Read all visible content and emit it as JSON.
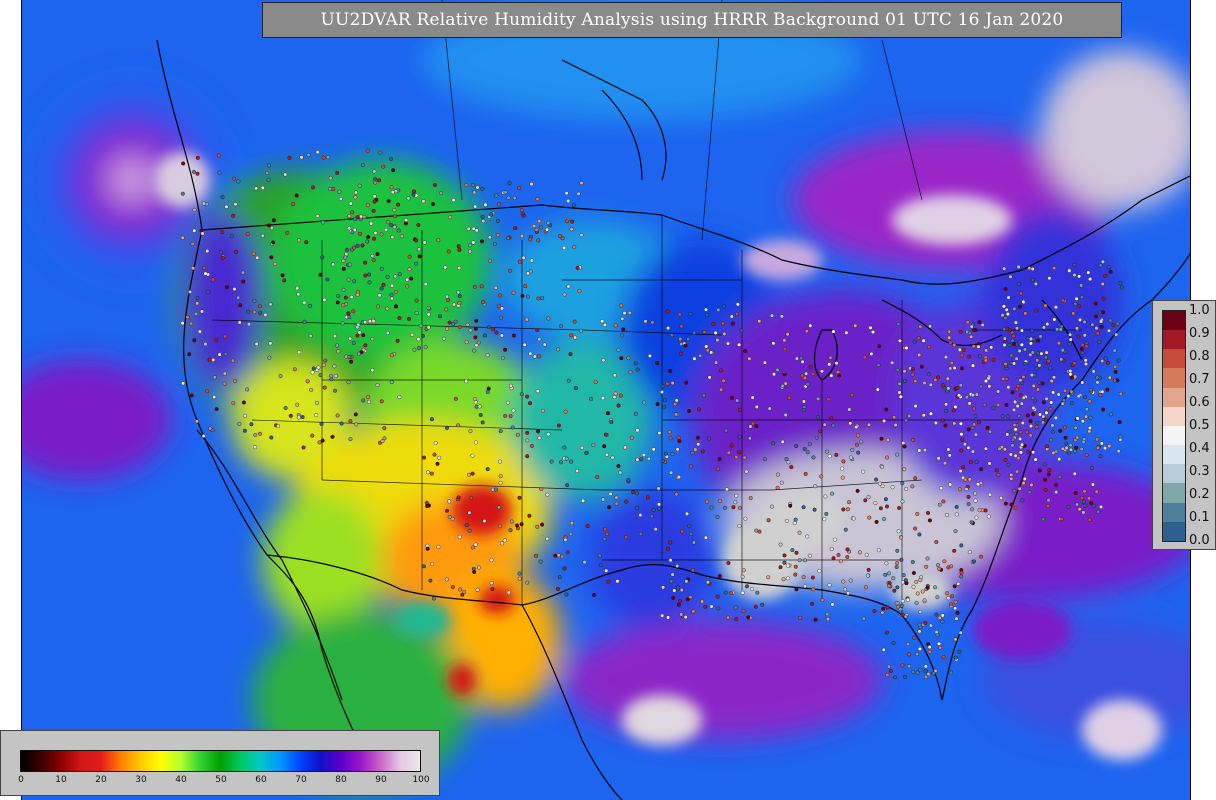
{
  "title": "UU2DVAR Relative Humidity Analysis using HRRR Background 01 UTC 16 Jan 2020",
  "colors": {
    "panel_gray": "#c4c4c4",
    "title_bg": "#8a8a8a",
    "ocean_blue": "#1f62f0",
    "dry_red": "#d41818",
    "moist_purple": "#6a12c8",
    "saturated_gray": "#cfcfcf"
  },
  "rh_colorbar": {
    "ticks": [
      "0",
      "10",
      "20",
      "30",
      "40",
      "50",
      "60",
      "70",
      "80",
      "90",
      "100"
    ],
    "colors": [
      "#000000",
      "#3a0000",
      "#8a0000",
      "#d41616",
      "#e31b1b",
      "#ff7f00",
      "#ffc800",
      "#ffff00",
      "#b4ff2d",
      "#32d232",
      "#00a000",
      "#00c864",
      "#00c8c8",
      "#0096ff",
      "#0044ff",
      "#1010c8",
      "#5a00c8",
      "#9a14c8",
      "#c864c8",
      "#e6c8e6",
      "#e8e8e8"
    ]
  },
  "residual_legend": {
    "labels": [
      "1.0",
      "0.9",
      "0.8",
      "0.7",
      "0.6",
      "0.5",
      "0.4",
      "0.3",
      "0.2",
      "0.1",
      "0.0"
    ],
    "colors": [
      "#6a0014",
      "#a31a26",
      "#c84a38",
      "#d77a5a",
      "#e0a58a",
      "#f3d6c8",
      "#f4f4f4",
      "#d8e6ef",
      "#b6cbd8",
      "#7fa7a8",
      "#4f7f9a",
      "#2f5f8f"
    ]
  },
  "icons": [
    "station-dot-icon"
  ]
}
